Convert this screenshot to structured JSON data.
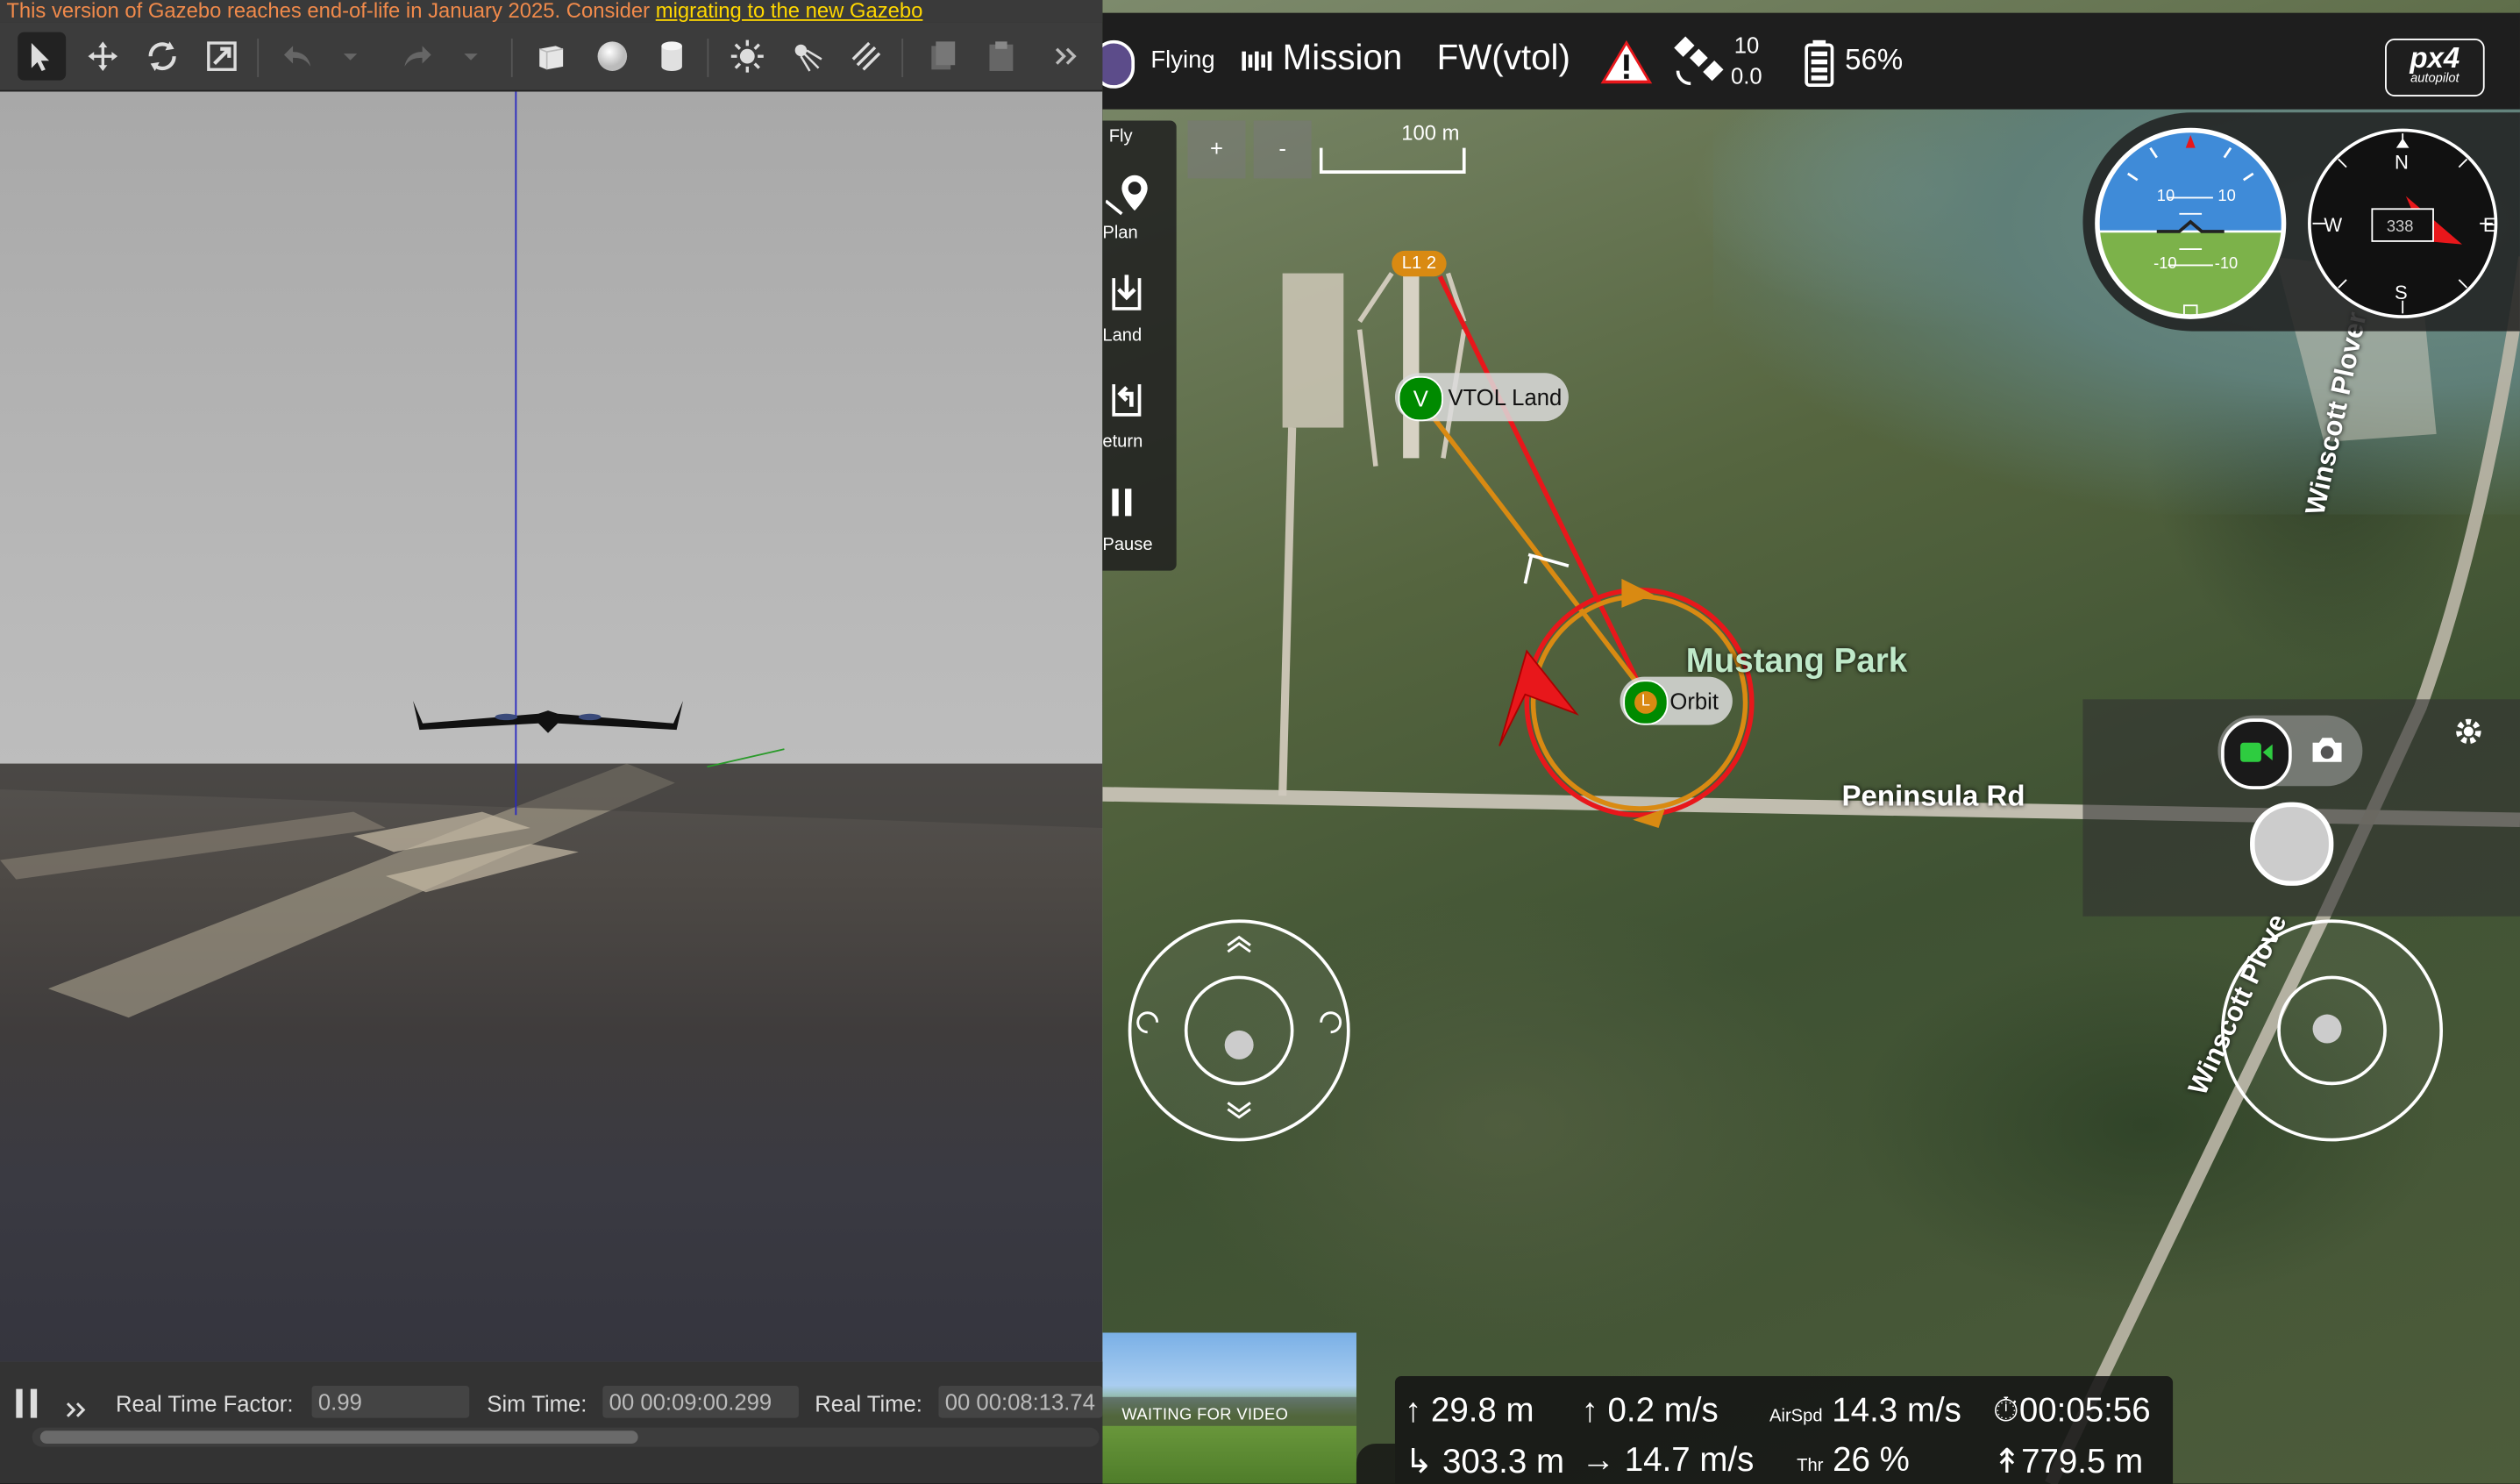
{
  "gazebo": {
    "banner_text": "This version of Gazebo reaches end-of-life in January 2025. Consider ",
    "banner_link": "migrating to the new Gazebo",
    "toolbar": [
      "select-icon",
      "translate-icon",
      "rotate-icon",
      "scale-icon",
      "undo-icon",
      "undo-menu-icon",
      "redo-icon",
      "redo-menu-icon",
      "box-icon",
      "sphere-icon",
      "cylinder-icon",
      "point-light-icon",
      "spot-light-icon",
      "directional-light-icon",
      "copy-icon",
      "paste-icon",
      "more-icon"
    ],
    "status": {
      "rtf_label": "Real Time Factor:",
      "rtf_value": "0.99",
      "sim_label": "Sim Time:",
      "sim_value": "00 00:09:00.299",
      "real_label": "Real Time:",
      "real_value": "00 00:08:13.74"
    }
  },
  "qgc": {
    "topbar": {
      "flight_state": "Flying",
      "flight_mode": "Mission",
      "vehicle_type": "FW(vtol)",
      "gps_sats": "10",
      "gps_hdop": "0.0",
      "battery": "56%",
      "logo": "px4",
      "logo_sub": "autopilot"
    },
    "left_toolbar": {
      "title": "Fly",
      "items": [
        "Plan",
        "Land",
        "eturn",
        "Pause"
      ]
    },
    "map": {
      "zoom_in": "+",
      "zoom_out": "-",
      "scale": "100 m",
      "labels": {
        "park": "Mustang Park",
        "road1": "Peninsula Rd",
        "road2": "Winscott Plover Rd",
        "road3": "Winscott Plove"
      },
      "waypoints": [
        {
          "marker": "V",
          "label": "VTOL Land"
        },
        {
          "marker": "L",
          "label": "Orbit"
        },
        {
          "marker": "L1 2",
          "label": ""
        }
      ]
    },
    "instruments": {
      "pitch_labels": [
        "10",
        "10",
        "-10",
        "-10"
      ],
      "compass": {
        "N": "N",
        "E": "E",
        "S": "S",
        "W": "W",
        "heading": "338"
      }
    },
    "video": {
      "status": "WAITING FOR VIDEO"
    },
    "stats": {
      "altitude": "29.8 m",
      "vertical_speed": "0.2 m/s",
      "airspeed_label": "AirSpd",
      "airspeed": "14.3 m/s",
      "flight_time": "00:05:56",
      "distance": "303.3 m",
      "ground_speed": "14.7 m/s",
      "throttle_label": "Thr",
      "throttle": "26 %",
      "distance_home": "779.5 m"
    },
    "colors": {
      "green": "#008a00",
      "orange": "#d98a12",
      "red": "#e8171b",
      "topbar": "#1e1e1e"
    }
  }
}
